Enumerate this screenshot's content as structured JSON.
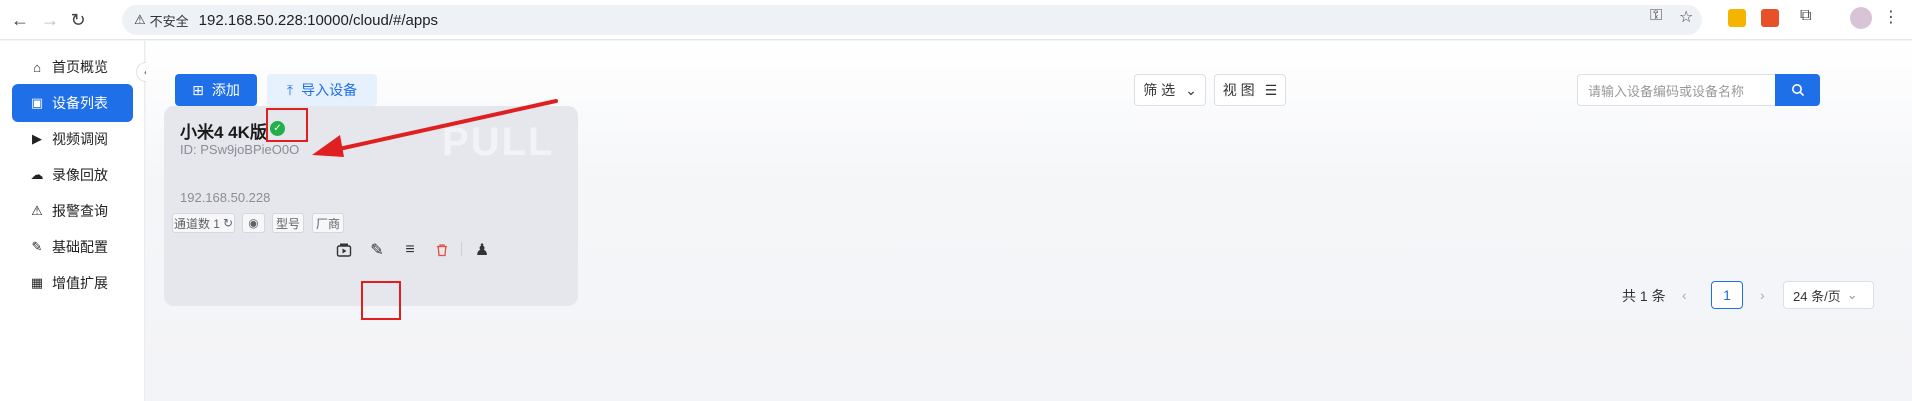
{
  "browser": {
    "security_label": "不安全",
    "url": "192.168.50.228:10000/cloud/#/apps"
  },
  "sidebar": {
    "items": [
      {
        "label": "首页概览",
        "icon": "home-icon"
      },
      {
        "label": "设备列表",
        "icon": "camera-icon",
        "active": true
      },
      {
        "label": "视频调阅",
        "icon": "play-circle-icon"
      },
      {
        "label": "录像回放",
        "icon": "cloud-icon"
      },
      {
        "label": "报警查询",
        "icon": "alarm-icon"
      },
      {
        "label": "基础配置",
        "icon": "edit-icon"
      },
      {
        "label": "增值扩展",
        "icon": "grid-icon"
      }
    ]
  },
  "toolbar": {
    "add_label": "添加",
    "import_label": "导入设备",
    "filter_label": "筛 选",
    "view_label": "视 图",
    "search_placeholder": "请输入设备编码或设备名称"
  },
  "device_card": {
    "name": "小米4 4K版",
    "id_text": "ID: PSw9joBPieO0O",
    "ip": "192.168.50.228",
    "watermark": "PULL",
    "tags": {
      "channels": "通道数 1",
      "model": "型号",
      "vendor": "厂商"
    },
    "status": "online",
    "status_color": "#22b04b"
  },
  "pagination": {
    "total_text": "共 1 条",
    "current_page": "1",
    "page_size_text": "24 条/页"
  },
  "colors": {
    "primary": "#1f6fe8",
    "highlight": "#e02020",
    "danger": "#e74c3c"
  }
}
